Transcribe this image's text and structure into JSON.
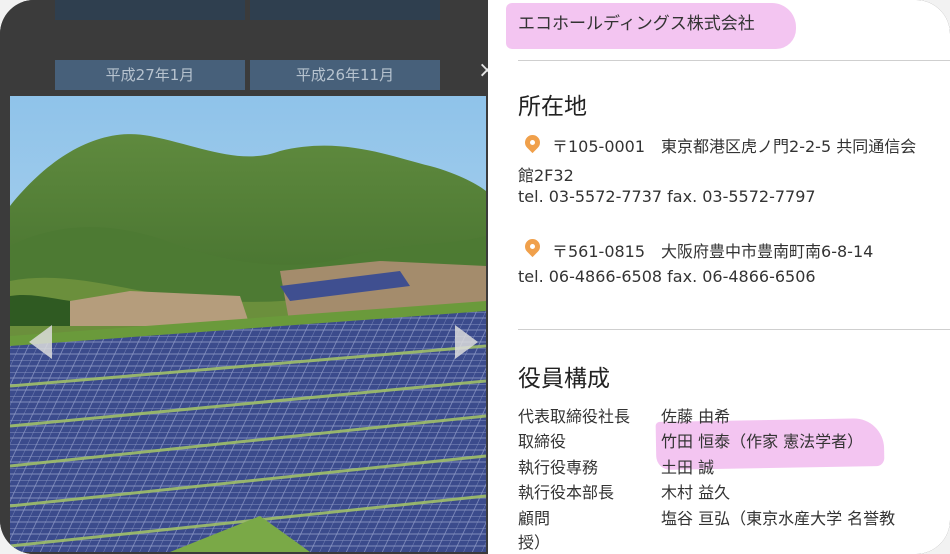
{
  "gallery": {
    "thumb_label_1": "平成27年1月",
    "thumb_label_2": "平成26年11月",
    "close_symbol": "×"
  },
  "company_name": "エコホールディングス株式会社",
  "location": {
    "title": "所在地",
    "office1": {
      "address_line1": "〒105-0001　東京都港区虎ノ門2-2-5 共同通信会",
      "address_line2": "館2F32",
      "phone_fax": "tel. 03-5572-7737  fax. 03-5572-7797"
    },
    "office2": {
      "address_line1": "〒561-0815　大阪府豊中市豊南町南6-8-14",
      "phone_fax": "tel. 06-4866-6508  fax. 06-4866-6506"
    }
  },
  "officers": {
    "title": "役員構成",
    "rows": [
      {
        "role": "代表取締役社長",
        "name": "佐藤 由希"
      },
      {
        "role": "取締役",
        "name": "竹田 恒泰（作家 憲法学者）"
      },
      {
        "role": "執行役専務",
        "name": "土田 誠"
      },
      {
        "role": "執行役本部長",
        "name": "木村 益久"
      },
      {
        "role": "顧問",
        "name": "塩谷 亘弘（東京水産大学 名誉教"
      }
    ],
    "name_continuation": "授）"
  },
  "colors": {
    "highlight": "#f2bff0",
    "pin": "#f0a04b",
    "thumb": "#47607a"
  }
}
